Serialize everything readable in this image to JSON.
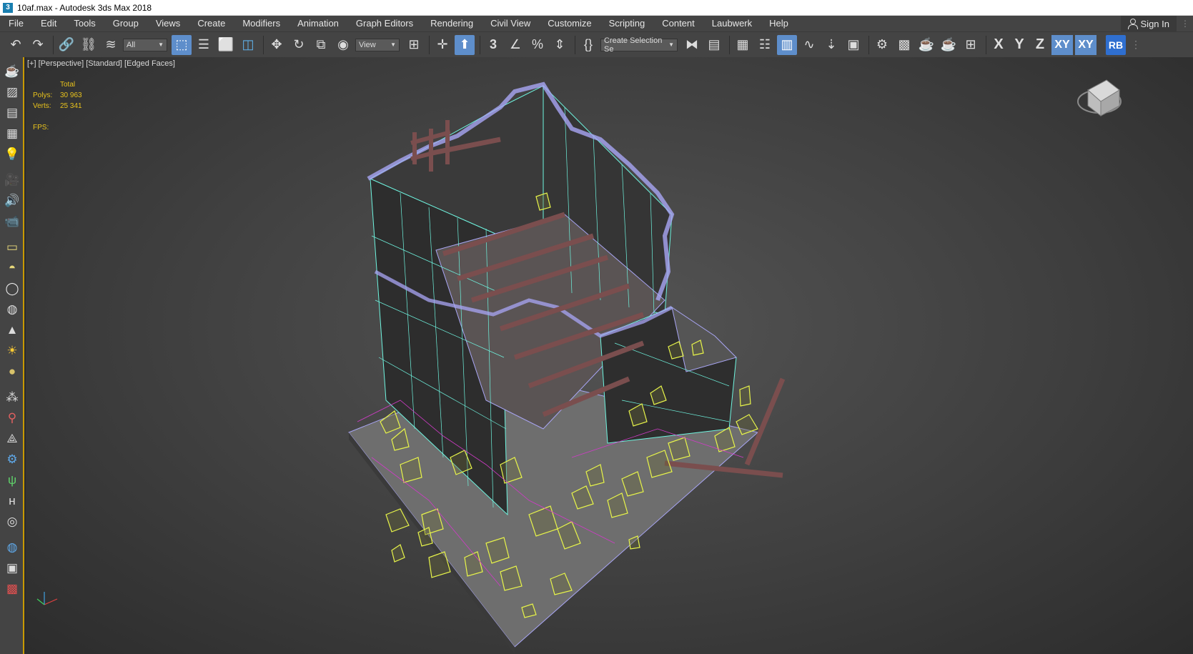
{
  "window": {
    "title": "10af.max - Autodesk 3ds Max 2018",
    "app_icon": "3"
  },
  "menu": {
    "items": [
      "File",
      "Edit",
      "Tools",
      "Group",
      "Views",
      "Create",
      "Modifiers",
      "Animation",
      "Graph Editors",
      "Rendering",
      "Civil View",
      "Customize",
      "Scripting",
      "Content",
      "Laubwerk",
      "Help"
    ],
    "sign_in": "Sign In"
  },
  "toolbar": {
    "filter_dropdown": "All",
    "reference_dropdown": "View",
    "snap_label": "3",
    "selection_set": "Create Selection Se",
    "axis_x": "X",
    "axis_y": "Y",
    "axis_z": "Z",
    "axis_xy": "XY",
    "axis_xy2": "XY",
    "rb": "RB"
  },
  "viewport": {
    "label": "[+] [Perspective] [Standard] [Edged Faces]",
    "stats": {
      "header": "Total",
      "polys_label": "Polys:",
      "polys_value": "30 963",
      "verts_label": "Verts:",
      "verts_value": "25 341",
      "fps_label": "FPS:"
    }
  },
  "colors": {
    "menu_bg": "#444444",
    "stats_text": "#e8c21c",
    "active_button": "#5e8ecb",
    "viewport_border": "#c99a00",
    "wire_cyan": "#6ff5e0",
    "wire_lavender": "#a9a6f5",
    "wire_yellow": "#e8f54a",
    "wire_magenta": "#d23bc9"
  }
}
